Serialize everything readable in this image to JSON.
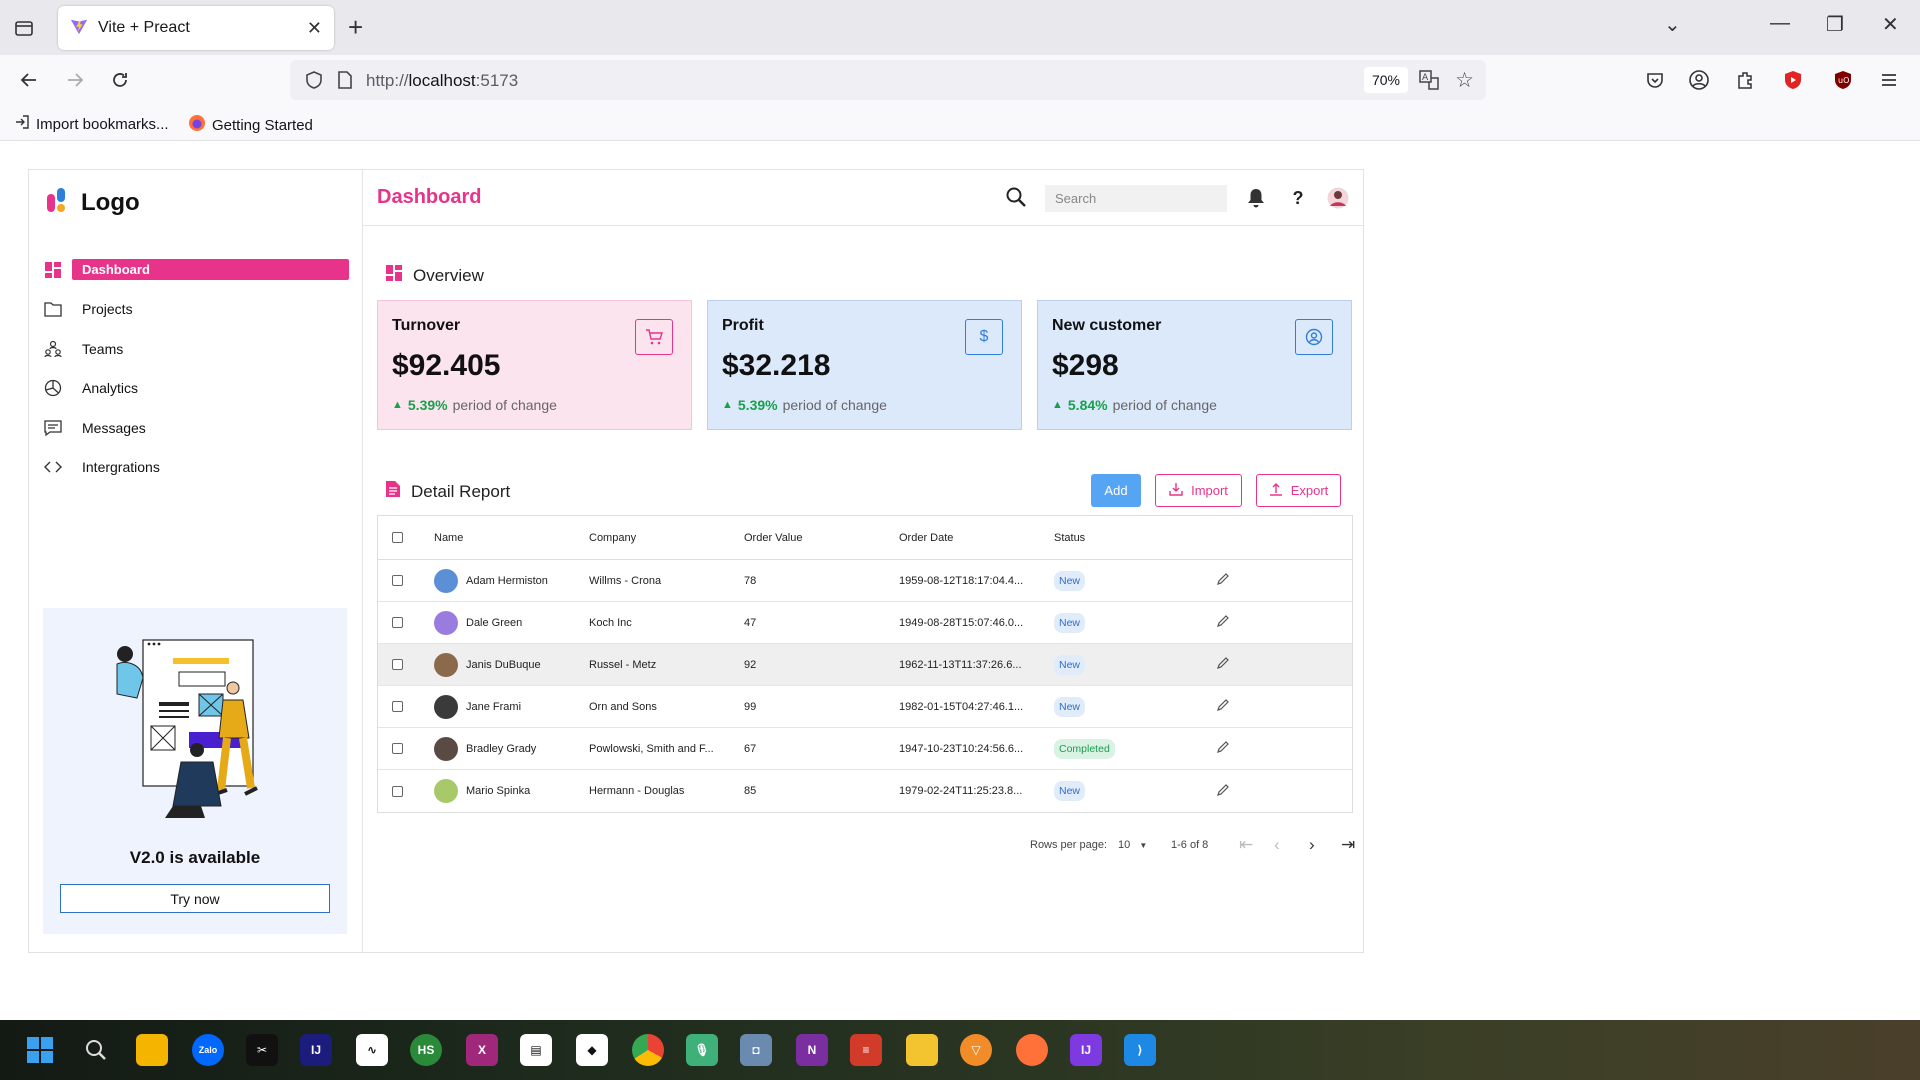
{
  "browser": {
    "tab_title": "Vite + Preact",
    "url_scheme": "http://",
    "url_host": "localhost",
    "url_port": ":5173",
    "zoom": "70%",
    "bookmarks": [
      "Import bookmarks...",
      "Getting Started"
    ]
  },
  "sidebar": {
    "logo_text": "Logo",
    "items": [
      {
        "label": "Dashboard",
        "icon": "dashboard-icon",
        "active": true
      },
      {
        "label": "Projects",
        "icon": "folder-icon"
      },
      {
        "label": "Teams",
        "icon": "teams-icon"
      },
      {
        "label": "Analytics",
        "icon": "pie-chart-icon"
      },
      {
        "label": "Messages",
        "icon": "message-icon"
      },
      {
        "label": "Intergrations",
        "icon": "code-icon"
      }
    ],
    "promo": {
      "title": "V2.0 is available",
      "button": "Try now"
    }
  },
  "header": {
    "title": "Dashboard",
    "search_placeholder": "Search"
  },
  "overview": {
    "title": "Overview",
    "cards": [
      {
        "title": "Turnover",
        "value": "$92.405",
        "change": "5.39%",
        "change_label": "period of change",
        "icon": "cart-icon"
      },
      {
        "title": "Profit",
        "value": "$32.218",
        "change": "5.39%",
        "change_label": "period of change",
        "icon": "dollar-icon"
      },
      {
        "title": "New customer",
        "value": "$298",
        "change": "5.84%",
        "change_label": "period of change",
        "icon": "user-circle-icon"
      }
    ]
  },
  "report": {
    "title": "Detail Report",
    "buttons": {
      "add": "Add",
      "import": "Import",
      "export": "Export"
    },
    "columns": [
      "Name",
      "Company",
      "Order Value",
      "Order Date",
      "Status"
    ],
    "rows": [
      {
        "name": "Adam Hermiston",
        "company": "Willms - Crona",
        "value": "78",
        "date": "1959-08-12T18:17:04.4...",
        "status": "New",
        "avatar": "#5b8fd6"
      },
      {
        "name": "Dale Green",
        "company": "Koch Inc",
        "value": "47",
        "date": "1949-08-28T15:07:46.0...",
        "status": "New",
        "avatar": "#9a7be0"
      },
      {
        "name": "Janis DuBuque",
        "company": "Russel - Metz",
        "value": "92",
        "date": "1962-11-13T11:37:26.6...",
        "status": "New",
        "avatar": "#8a6a4a"
      },
      {
        "name": "Jane Frami",
        "company": "Orn and Sons",
        "value": "99",
        "date": "1982-01-15T04:27:46.1...",
        "status": "New",
        "avatar": "#3a3a3a"
      },
      {
        "name": "Bradley Grady",
        "company": "Powlowski, Smith and F...",
        "value": "67",
        "date": "1947-10-23T10:24:56.6...",
        "status": "Completed",
        "avatar": "#5a4a44"
      },
      {
        "name": "Mario Spinka",
        "company": "Hermann - Douglas",
        "value": "85",
        "date": "1979-02-24T11:25:23.8...",
        "status": "New",
        "avatar": "#a8c96a"
      }
    ],
    "pagination": {
      "rows_per_page_label": "Rows per page:",
      "rows_per_page": "10",
      "range": "1-6 of 8"
    }
  }
}
